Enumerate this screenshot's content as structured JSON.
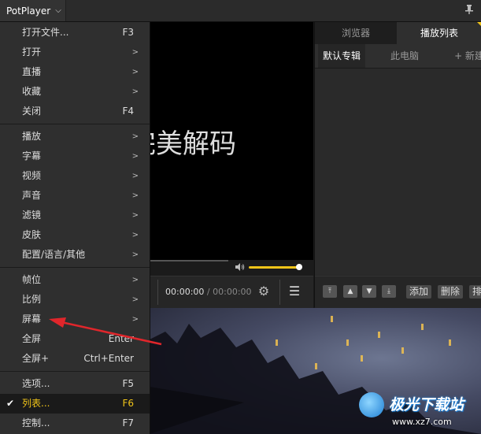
{
  "titlebar": {
    "app_name": "PotPlayer",
    "chevron": "⌵",
    "pin_icon": "pin-icon"
  },
  "video": {
    "overlay_text": "完美解码",
    "overlay_text_visible": "美解码"
  },
  "controls": {
    "time_current": "00:00:00",
    "time_sep": "/",
    "time_total": "00:00:00"
  },
  "panel": {
    "tabs": [
      "浏览器",
      "播放列表"
    ],
    "subtabs": [
      "默认专辑",
      "此电脑",
      "+ 新建"
    ],
    "toolbar": {
      "add": "添加",
      "delete": "删除",
      "more": "排"
    }
  },
  "menu": {
    "groups": [
      [
        {
          "label": "打开文件...",
          "shortcut": "F3"
        },
        {
          "label": "打开",
          "submenu": true
        },
        {
          "label": "直播",
          "submenu": true
        },
        {
          "label": "收藏",
          "submenu": true
        },
        {
          "label": "关闭",
          "shortcut": "F4"
        }
      ],
      [
        {
          "label": "播放",
          "submenu": true
        },
        {
          "label": "字幕",
          "submenu": true
        },
        {
          "label": "视频",
          "submenu": true
        },
        {
          "label": "声音",
          "submenu": true
        },
        {
          "label": "滤镜",
          "submenu": true
        },
        {
          "label": "皮肤",
          "submenu": true
        },
        {
          "label": "配置/语言/其他",
          "submenu": true
        }
      ],
      [
        {
          "label": "帧位",
          "submenu": true
        },
        {
          "label": "比例",
          "submenu": true
        },
        {
          "label": "屏幕",
          "submenu": true
        },
        {
          "label": "全屏",
          "shortcut": "Enter"
        },
        {
          "label": "全屏+",
          "shortcut": "Ctrl+Enter"
        }
      ],
      [
        {
          "label": "选项...",
          "shortcut": "F5"
        },
        {
          "label": "列表...",
          "shortcut": "F6",
          "checked": true,
          "selected": true
        },
        {
          "label": "控制...",
          "shortcut": "F7"
        }
      ]
    ],
    "submenu_arrow": ">",
    "check_glyph": "✔"
  },
  "watermark": {
    "title": "极光下载站",
    "url": "www.xz7.com"
  },
  "colors": {
    "accent": "#f0c419",
    "annotation_arrow": "#e0262b",
    "menu_bg": "#2f2f2f"
  }
}
